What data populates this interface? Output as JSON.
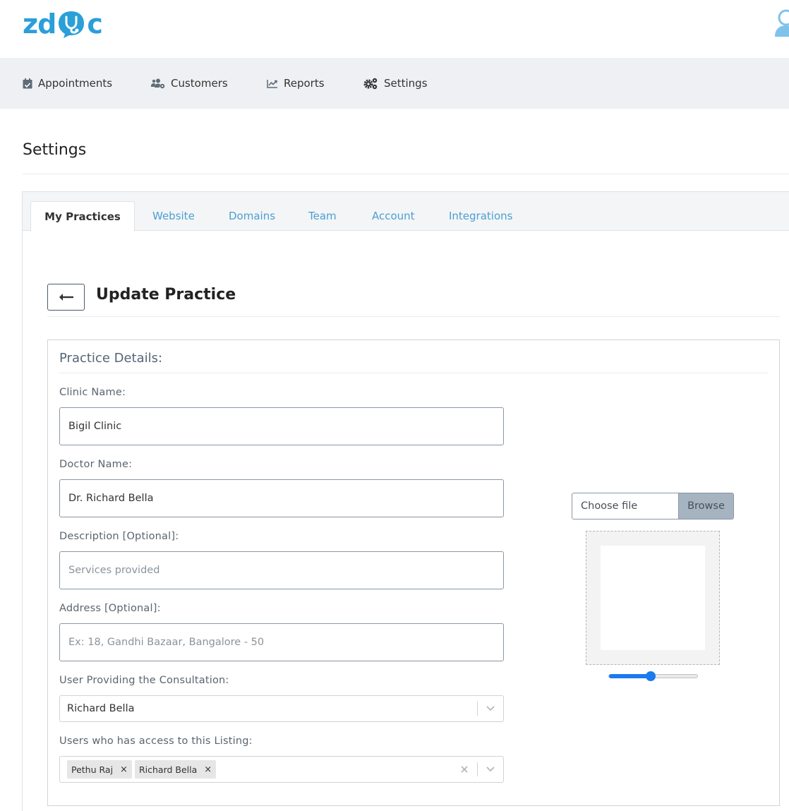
{
  "app": {
    "logo_text_1": "zd",
    "logo_text_2": "c",
    "brand_color": "#2a9fd8"
  },
  "nav": {
    "items": [
      {
        "label": "Appointments",
        "icon": "calendar-check-icon"
      },
      {
        "label": "Customers",
        "icon": "users-cog-icon"
      },
      {
        "label": "Reports",
        "icon": "chart-line-icon"
      },
      {
        "label": "Settings",
        "icon": "cogs-icon"
      }
    ]
  },
  "page": {
    "title": "Settings"
  },
  "tabs": [
    {
      "label": "My Practices",
      "active": true
    },
    {
      "label": "Website"
    },
    {
      "label": "Domains"
    },
    {
      "label": "Team"
    },
    {
      "label": "Account"
    },
    {
      "label": "Integrations"
    }
  ],
  "practice": {
    "heading": "Update Practice",
    "section_title": "Practice Details:",
    "clinic_name": {
      "label": "Clinic Name:",
      "value": "Bigil Clinic"
    },
    "doctor_name": {
      "label": "Doctor Name:",
      "value": "Dr. Richard Bella"
    },
    "description": {
      "label": "Description [Optional]:",
      "placeholder": "Services provided"
    },
    "address": {
      "label": "Address [Optional]:",
      "placeholder": "Ex: 18, Gandhi Bazaar, Bangalore - 50"
    },
    "consultant": {
      "label": "User Providing the Consultation:",
      "value": "Richard Bella"
    },
    "access": {
      "label": "Users who has access to this Listing:",
      "users": [
        "Pethu Raj",
        "Richard Bella"
      ],
      "remove_glyph": "×"
    }
  },
  "upload": {
    "choose_label": "Choose file",
    "browse_label": "Browse",
    "zoom_fraction": 0.47,
    "slider_color": "#1a7af0"
  }
}
